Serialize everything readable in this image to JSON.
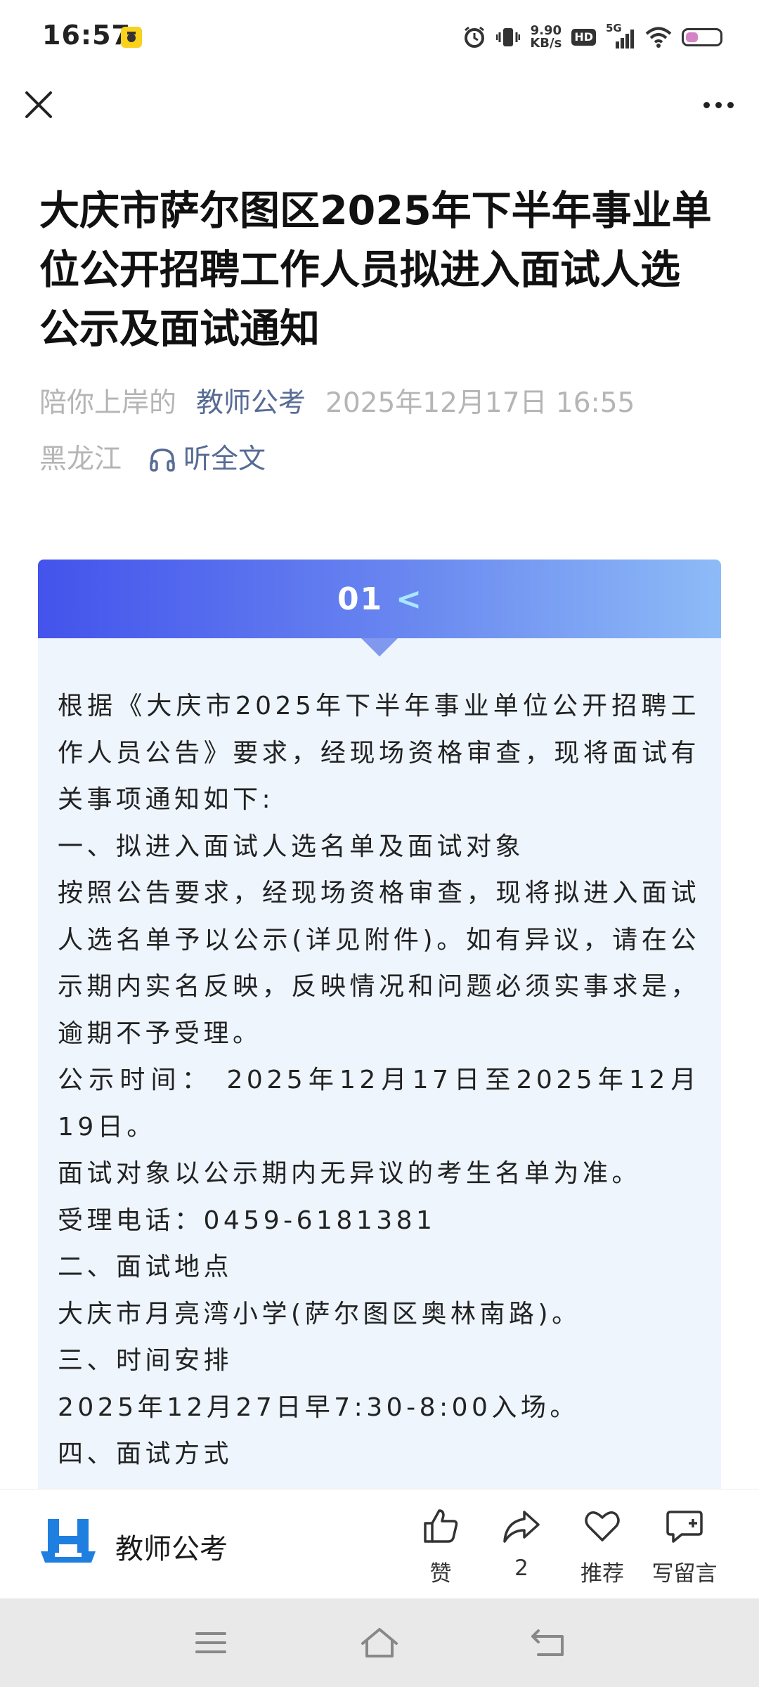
{
  "status_bar": {
    "time": "16:57",
    "net_speed_value": "9.90",
    "net_speed_unit": "KB/s",
    "hd_label": "HD",
    "network_label": "5G",
    "icons": [
      "alarm-icon",
      "vibrate-icon",
      "signal-icon",
      "wifi-icon",
      "battery-icon"
    ],
    "battery_level": 0.2
  },
  "nav": {
    "close_icon": "close-icon",
    "more_icon": "more-icon"
  },
  "article": {
    "title": "大庆市萨尔图区2025年下半年事业单位公开招聘工作人员拟进入面试人选公示及面试通知",
    "author": "陪你上岸的",
    "account": "教师公考",
    "datetime": "2025年12月17日 16:55",
    "region": "黑龙江",
    "listen_label": "听全文"
  },
  "card": {
    "number": "01",
    "chevron": "<",
    "paragraphs": [
      "根据《大庆市2025年下半年事业单位公开招聘工作人员公告》要求，经现场资格审查，现将面试有关事项通知如下:",
      "一、拟进入面试人选名单及面试对象",
      "按照公告要求，经现场资格审查，现将拟进入面试人选名单予以公示(详见附件)。如有异议，请在公示期内实名反映，反映情况和问题必须实事求是，逾期不予受理。",
      "公示时间： 2025年12月17日至2025年12月19日。",
      "面试对象以公示期内无异议的考生名单为准。",
      "受理电话：0459-6181381",
      "二、面试地点",
      "大庆市月亮湾小学(萨尔图区奥林南路)。",
      "三、时间安排",
      "2025年12月27日早7:30-8:00入场。",
      "四、面试方式"
    ]
  },
  "action_bar": {
    "account_name": "教师公考",
    "like_label": "赞",
    "share_count": "2",
    "recommend_label": "推荐",
    "comment_label": "写留言",
    "accent_color": "#1f7fe0"
  }
}
